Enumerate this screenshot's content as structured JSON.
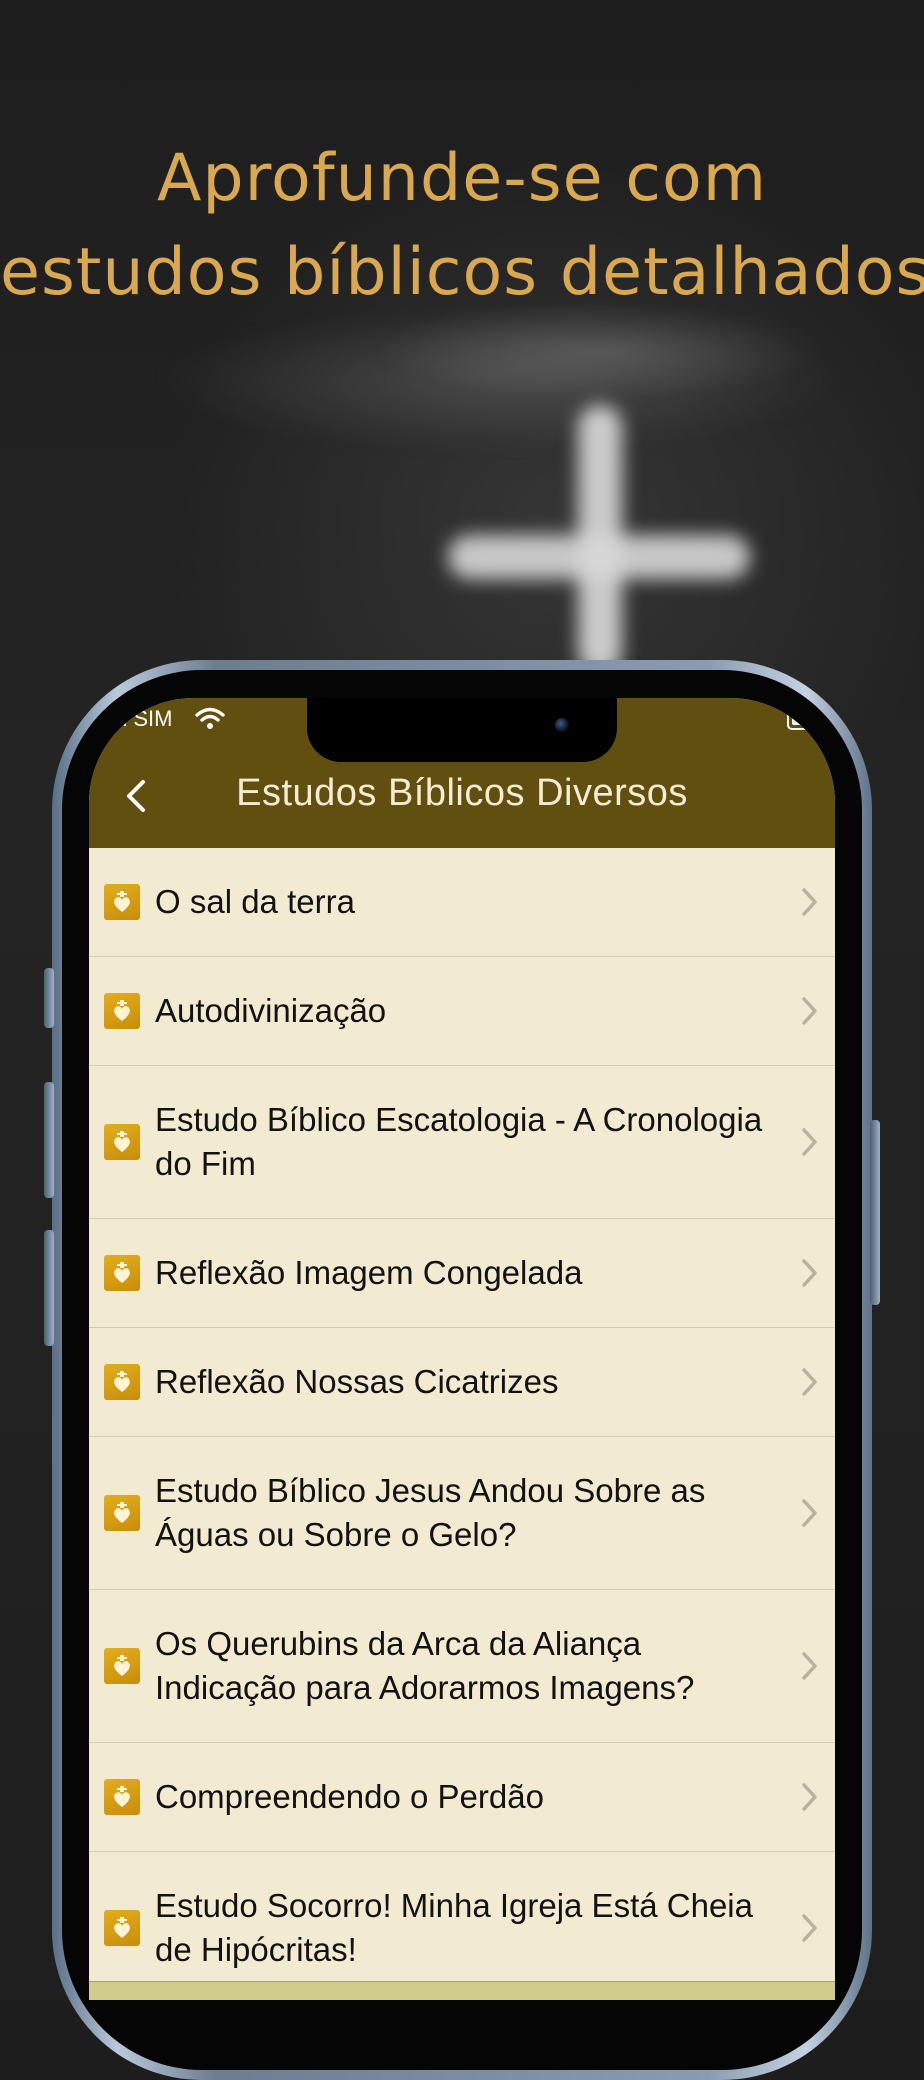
{
  "headline": {
    "line1": "Aprofunde-se com",
    "line2": "estudos bíblicos detalhados"
  },
  "status_bar": {
    "carrier": "n SIM",
    "wifi_icon": "wifi-icon",
    "battery_icon": "battery-icon"
  },
  "navbar": {
    "title": "Estudos Bíblicos Diversos",
    "back_icon": "chevron-left-icon"
  },
  "list": {
    "item_icon": "heart-book-icon",
    "chevron_icon": "chevron-right-icon",
    "items": [
      {
        "label": "O sal da terra"
      },
      {
        "label": "Autodivinização"
      },
      {
        "label": "Estudo Bíblico Escatologia - A Cronologia do Fim"
      },
      {
        "label": "Reflexão Imagem Congelada"
      },
      {
        "label": "Reflexão Nossas Cicatrizes"
      },
      {
        "label": "Estudo Bíblico Jesus Andou Sobre as Águas ou Sobre o Gelo?"
      },
      {
        "label": "Os Querubins da Arca da Aliança Indicação para Adorarmos Imagens?"
      },
      {
        "label": "Compreendendo o Perdão"
      },
      {
        "label": "Estudo Socorro! Minha Igreja Está Cheia de Hipócritas!"
      }
    ]
  },
  "colors": {
    "headline": "#d9a84f",
    "navbar": "#614f0f",
    "list_background": "#f3ead2",
    "icon_gold": "#d79f14"
  }
}
